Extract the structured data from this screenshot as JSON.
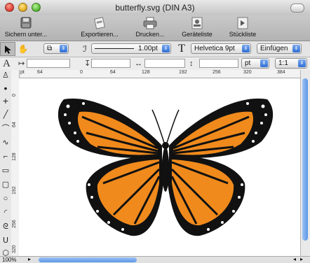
{
  "window": {
    "title": "butterfly.svg (DIN A3)"
  },
  "toolbar": {
    "save_label": "Sichern unter...",
    "export_label": "Exportieren...",
    "print_label": "Drucken...",
    "devices_label": "Geräteliste",
    "parts_label": "Stückliste"
  },
  "style_bar": {
    "stroke_width": "1.00pt",
    "font": "Helvetica 9pt",
    "insert_mode": "Einfügen"
  },
  "position_bar": {
    "unit": "pt",
    "scale": "1:1"
  },
  "rulers": {
    "unit_label": "pt",
    "h_ticks": [
      "64",
      "0",
      "64",
      "128",
      "192",
      "256",
      "320",
      "384"
    ],
    "v_ticks": [
      "0",
      "64",
      "128",
      "192",
      "256",
      "320"
    ]
  },
  "status": {
    "zoom": "100%"
  },
  "icons": {
    "pointer": "arrow-pointer-icon",
    "hand": "hand-icon",
    "text": "text-tool-icon"
  },
  "colors": {
    "wing_orange": "#F08A1C",
    "wing_black": "#111111",
    "accent_blue": "#3D7BE0"
  }
}
